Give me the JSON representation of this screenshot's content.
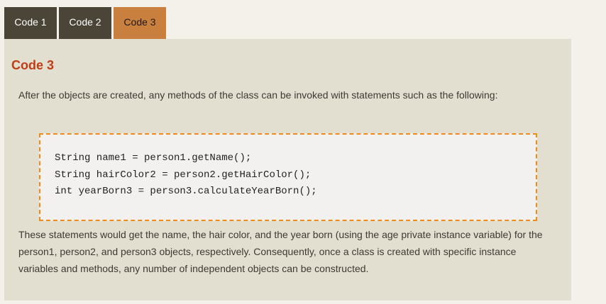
{
  "tabs": [
    {
      "label": "Code 1",
      "active": false
    },
    {
      "label": "Code 2",
      "active": false
    },
    {
      "label": "Code 3",
      "active": true
    }
  ],
  "panel": {
    "title": "Code 3",
    "intro": "After the objects are created, any methods of the class can be invoked with statements such as the following:",
    "code_lines": [
      "String name1 = person1.getName();",
      "String hairColor2 = person2.getHairColor();",
      "int yearBorn3 = person3.calculateYearBorn();"
    ],
    "outro_lines": [
      "These statements would get the name, the hair color, and the year born (using the age private instance variable) for the",
      "person1, person2, and person3 objects, respectively. Consequently, once a class is created with specific instance",
      "variables and methods, any number of independent objects can be constructed."
    ]
  },
  "colors": {
    "tab_dark": "#4b4538",
    "tab_active": "#c9803f",
    "panel_bg": "#e3dfd0",
    "title": "#c03c14",
    "code_border": "#f08a1a"
  }
}
